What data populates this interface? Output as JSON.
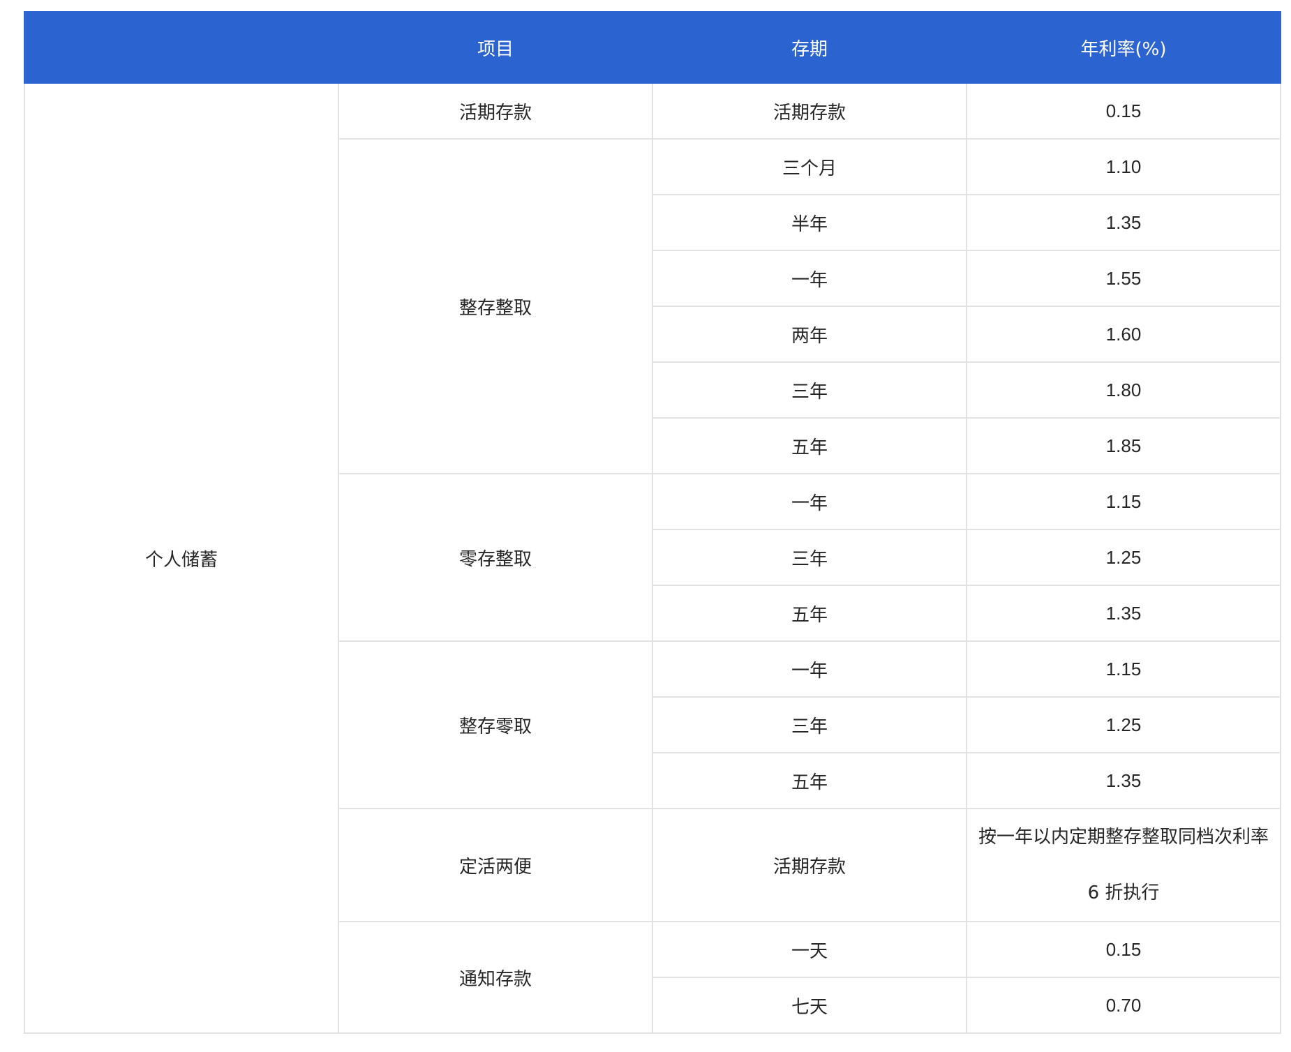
{
  "title": "",
  "table": {
    "headers": [
      "",
      "项目",
      "存期",
      "年利率(%)"
    ],
    "category": "个人储蓄",
    "groups": [
      {
        "project": "活期存款",
        "rows": [
          {
            "term": "活期存款",
            "rate": "0.15"
          }
        ]
      },
      {
        "project": "整存整取",
        "rows": [
          {
            "term": "三个月",
            "rate": "1.10"
          },
          {
            "term": "半年",
            "rate": "1.35"
          },
          {
            "term": "一年",
            "rate": "1.55"
          },
          {
            "term": "两年",
            "rate": "1.60"
          },
          {
            "term": "三年",
            "rate": "1.80"
          },
          {
            "term": "五年",
            "rate": "1.85"
          }
        ]
      },
      {
        "project": "零存整取",
        "rows": [
          {
            "term": "一年",
            "rate": "1.15"
          },
          {
            "term": "三年",
            "rate": "1.25"
          },
          {
            "term": "五年",
            "rate": "1.35"
          }
        ]
      },
      {
        "project": "整存零取",
        "rows": [
          {
            "term": "一年",
            "rate": "1.15"
          },
          {
            "term": "三年",
            "rate": "1.25"
          },
          {
            "term": "五年",
            "rate": "1.35"
          }
        ]
      },
      {
        "project": "定活两便",
        "rows": [
          {
            "term": "活期存款",
            "rate": "按一年以内定期整存整取同档次利率 6 折执行",
            "note": true
          }
        ]
      },
      {
        "project": "通知存款",
        "rows": [
          {
            "term": "一天",
            "rate": "0.15"
          },
          {
            "term": "七天",
            "rate": "0.70"
          }
        ]
      }
    ]
  },
  "colors": {
    "header_bg": "#2b64d1",
    "header_text": "#ffffff",
    "grid": "#e2e2e2",
    "text": "#262626"
  }
}
